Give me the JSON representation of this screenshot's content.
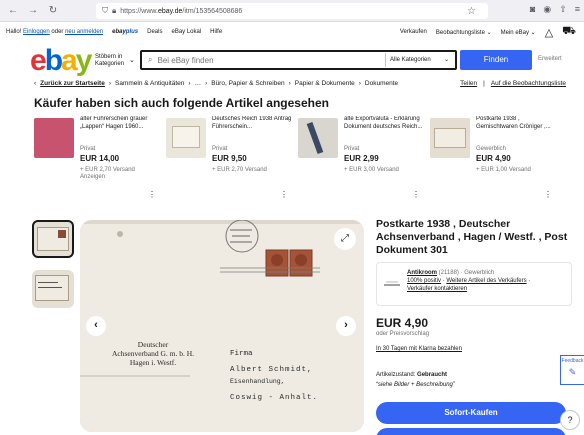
{
  "browser": {
    "url_prefix": "https://www.",
    "url_domain": "ebay.de",
    "url_path": "/itm/153564508686"
  },
  "top_nav": {
    "greeting": "Hallo!",
    "sign_in": "Einloggen",
    "or": "oder",
    "register": "neu anmelden",
    "ebay_plus": "ebay",
    "ebay_plus_suffix": "plus",
    "deals": "Deals",
    "local": "eBay Lokal",
    "help": "Hilfe",
    "sell": "Verkaufen",
    "watchlist": "Beobachtungsliste ⌄",
    "my_ebay": "Mein eBay ⌄"
  },
  "header": {
    "categories_label": "Stöbern in Kategorien",
    "search_placeholder": "Bei eBay finden",
    "category_select": "Alle Kategorien",
    "find_button": "Finden",
    "advanced": "Erweitert"
  },
  "breadcrumb": {
    "back": "Zurück zur Startseite",
    "items": [
      "›",
      "Sammeln & Antiquitäten",
      "›",
      "…",
      "›",
      "Büro, Papier & Schreiben",
      "›",
      "Papier & Dokumente",
      "›",
      "Dokumente"
    ],
    "share": "Teilen",
    "watch": "Auf die Beobachtungsliste"
  },
  "related": {
    "title": "Käufer haben sich auch folgende Artikel angesehen",
    "items": [
      {
        "title": "alter Führerschein grauer „Lappen“ Hagen 1960...",
        "condition": "Privat",
        "price": "EUR 14,00",
        "shipping": "+ EUR 2,70 Versand",
        "extra": "Anzeigen",
        "color": "#c8536f"
      },
      {
        "title": "Deutsches Reich 1938 Antrag Führerschein...",
        "condition": "Privat",
        "price": "EUR 9,50",
        "shipping": "+ EUR 2,70 Versand",
        "extra": "",
        "color": "#e9e4d8"
      },
      {
        "title": "alte Exportvaluta - Erklärung Dokument deutsches Reich...",
        "condition": "Privat",
        "price": "EUR 2,99",
        "shipping": "+ EUR 3,00 Versand",
        "extra": "",
        "color": "#d9d6d0"
      },
      {
        "title": "Postkarte 1938 , Gemischtwaren Cröniger ,...",
        "condition": "Gewerblich",
        "price": "EUR 4,90",
        "shipping": "+ EUR 1,00 Versand",
        "extra": "",
        "color": "#e4ddd0"
      }
    ]
  },
  "item": {
    "title": "Postkarte 1938 , Deutscher Achsenverband , Hagen / Westf. , Post Dokument 301",
    "seller_name": "Antikroom",
    "seller_score": "(21188) · Gewerblich",
    "seller_positive": "100% positiv",
    "seller_more": "Weitere Artikel des Verkäufers",
    "seller_contact": "Verkäufer kontaktieren",
    "price": "EUR 4,90",
    "or_best": "oder Preisvorschlag",
    "klarna": "In 30 Tagen mit Klarna bezahlen",
    "condition_label": "Artikelzustand:",
    "condition_value": "Gebraucht",
    "condition_note": "“siehe Bilder + Beschreibung”",
    "buy_now": "Sofort-Kaufen"
  },
  "postcard": {
    "sender_line1": "Deutscher",
    "sender_line2": "Achsenverband G. m. b. H.",
    "sender_line3": "Hagen i. Westf.",
    "firm": "Firma",
    "addressee": "Albert Schmidt,",
    "business": "Eisenhandlung,",
    "city": "Coswig - Anhalt."
  },
  "widgets": {
    "feedback": "Feedback",
    "help": "?"
  }
}
